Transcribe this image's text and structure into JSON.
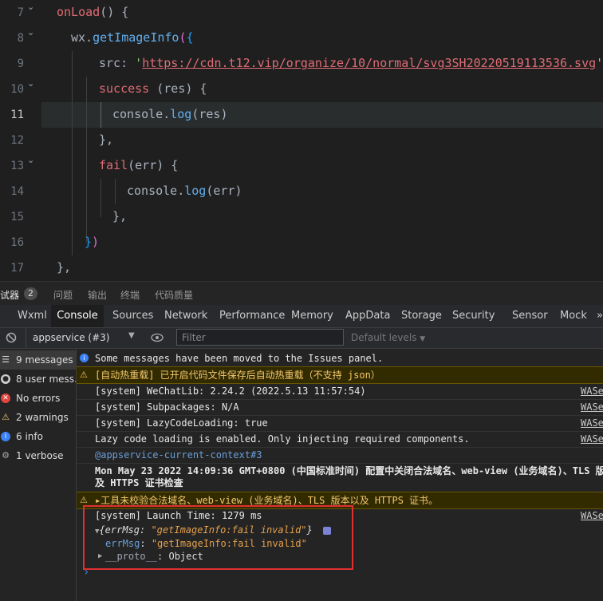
{
  "editor": {
    "line_numbers": [
      "7",
      "8",
      "9",
      "10",
      "11",
      "12",
      "13",
      "14",
      "15",
      "16",
      "17"
    ],
    "current_line": "11",
    "code": {
      "l7_fn": "onLoad",
      "l7_rest": "() {",
      "l8_obj": "wx.",
      "l8_fn": "getImageInfo",
      "l8_open": "(",
      "l8_brace": "{",
      "l9_key": "src: ",
      "l9_q1": "'",
      "l9_url": "https://cdn.t12.vip/organize/10/normal/svg3SH20220519113536.svg",
      "l9_q2": "',",
      "l10_fn": "success",
      "l10_rest": " (res) {",
      "l11_obj": "console.",
      "l11_fn": "log",
      "l11_arg": "(res)",
      "l12": "},",
      "l13_fn": "fail",
      "l13_rest": "(err) {",
      "l14_obj": "console.",
      "l14_fn": "log",
      "l14_arg": "(err)",
      "l15": "},",
      "l16_brace": "}",
      "l16_paren": ")",
      "l17": "},"
    }
  },
  "bottom_tabs": {
    "debugger": "试器",
    "debugger_count": "2",
    "problems": "问题",
    "output": "输出",
    "terminal": "终端",
    "code_quality": "代码质量"
  },
  "devtools_tabs": [
    "Wxml",
    "Console",
    "Sources",
    "Network",
    "Performance",
    "Memory",
    "AppData",
    "Storage",
    "Security",
    "Sensor",
    "Mock"
  ],
  "devtools_more": "»",
  "filter_bar": {
    "context": "appservice (#3)",
    "filter_placeholder": "Filter",
    "levels": "Default levels"
  },
  "sidebar": [
    {
      "label": "9 messages",
      "icon": "list-icon"
    },
    {
      "label": "8 user mess…",
      "icon": "user-icon"
    },
    {
      "label": "No errors",
      "icon": "error-icon"
    },
    {
      "label": "2 warnings",
      "icon": "warning-icon"
    },
    {
      "label": "6 info",
      "icon": "info-icon"
    },
    {
      "label": "1 verbose",
      "icon": "verbose-icon"
    }
  ],
  "console": {
    "moved_msg": "Some messages have been moved to the Issues panel.",
    "hot_reload_warn": "[自动热重载] 已开启代码文件保存后自动热重载（不支持 json）",
    "lines": [
      {
        "text": "[system] WeChatLib: 2.24.2 (2022.5.13 11:57:54)",
        "src": "WASer"
      },
      {
        "text": "[system] Subpackages: N/A",
        "src": "WASer"
      },
      {
        "text": "[system] LazyCodeLoading: true",
        "src": "WASer"
      },
      {
        "text": "Lazy code loading is enabled. Only injecting required components.",
        "src": "WASer"
      }
    ],
    "context_label": "@appservice-current-context#3",
    "date_line1": "Mon May 23 2022 14:09:36 GMT+0800 (中国标准时间) 配置中关闭合法域名、web-view (业务域名)、TLS 版",
    "date_line2": "及 HTTPS 证书检查",
    "tools_warn": "▸工具未校验合法域名、web-view (业务域名)、TLS 版本以及 HTTPS 证书。",
    "launch_time": "[system] Launch Time: 1279 ms",
    "launch_src": "WASer",
    "obj_summary_key": "{errMsg: ",
    "obj_summary_val": "\"getImageInfo:fail invalid\"",
    "obj_summary_end": "}",
    "obj_prop_key": "errMsg",
    "obj_prop_val": "\"getImageInfo:fail invalid\"",
    "obj_proto_key": "__proto__",
    "obj_proto_val": ": Object",
    "prompt": "›"
  },
  "colors": {
    "highlight_box": "#e03030",
    "warning_text": "#f2c66d",
    "info_blue": "#3b82f6"
  }
}
